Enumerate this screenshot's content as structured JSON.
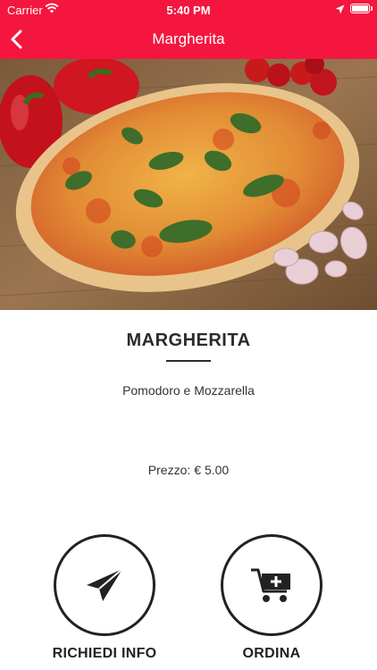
{
  "status_bar": {
    "carrier": "Carrier",
    "time": "5:40 PM"
  },
  "nav": {
    "title": "Margherita",
    "back_icon": "chevron-left-icon"
  },
  "product": {
    "name": "MARGHERITA",
    "description": "Pomodoro e Mozzarella",
    "price_label": "Prezzo:",
    "price_value": "€ 5.00"
  },
  "actions": [
    {
      "label": "RICHIEDI INFO",
      "icon": "paper-plane-icon"
    },
    {
      "label": "ORDINA",
      "icon": "cart-add-icon"
    }
  ],
  "colors": {
    "accent": "#f4163f",
    "text": "#2b2b2b"
  }
}
